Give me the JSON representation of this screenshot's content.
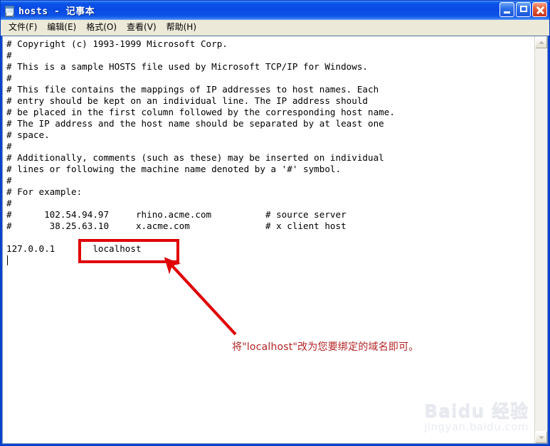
{
  "window": {
    "title": "hosts - 记事本",
    "icon": "notepad-icon",
    "buttons": {
      "minimize": "_",
      "maximize": "□",
      "close": "✕"
    }
  },
  "menubar": {
    "items": [
      {
        "label": "文件(F)"
      },
      {
        "label": "编辑(E)"
      },
      {
        "label": "格式(O)"
      },
      {
        "label": "查看(V)"
      },
      {
        "label": "帮助(H)"
      }
    ]
  },
  "editor": {
    "lines": [
      "# Copyright (c) 1993-1999 Microsoft Corp.",
      "#",
      "# This is a sample HOSTS file used by Microsoft TCP/IP for Windows.",
      "#",
      "# This file contains the mappings of IP addresses to host names. Each",
      "# entry should be kept on an individual line. The IP address should",
      "# be placed in the first column followed by the corresponding host name.",
      "# The IP address and the host name should be separated by at least one",
      "# space.",
      "#",
      "# Additionally, comments (such as these) may be inserted on individual",
      "# lines or following the machine name denoted by a '#' symbol.",
      "#",
      "# For example:",
      "#",
      "#      102.54.94.97     rhino.acme.com          # source server",
      "#       38.25.63.10     x.acme.com              # x client host",
      "",
      "127.0.0.1       localhost",
      ""
    ],
    "caret_line": 19
  },
  "scrollbar": {
    "up_arrow": "▲",
    "down_arrow": "▼"
  },
  "annotation": {
    "highlight_target": "localhost",
    "note": "将\"localhost\"改为您要绑定的域名即可。",
    "color": "#b32424",
    "box_color": "#e00000"
  },
  "watermark": {
    "main": "Baidu 经验",
    "sub": "jingyan.baidu.com"
  },
  "colors": {
    "titlebar_blue": "#0a4ae4",
    "menubar": "#ece9d8",
    "text": "#000000",
    "annotation_red": "#e00000"
  }
}
